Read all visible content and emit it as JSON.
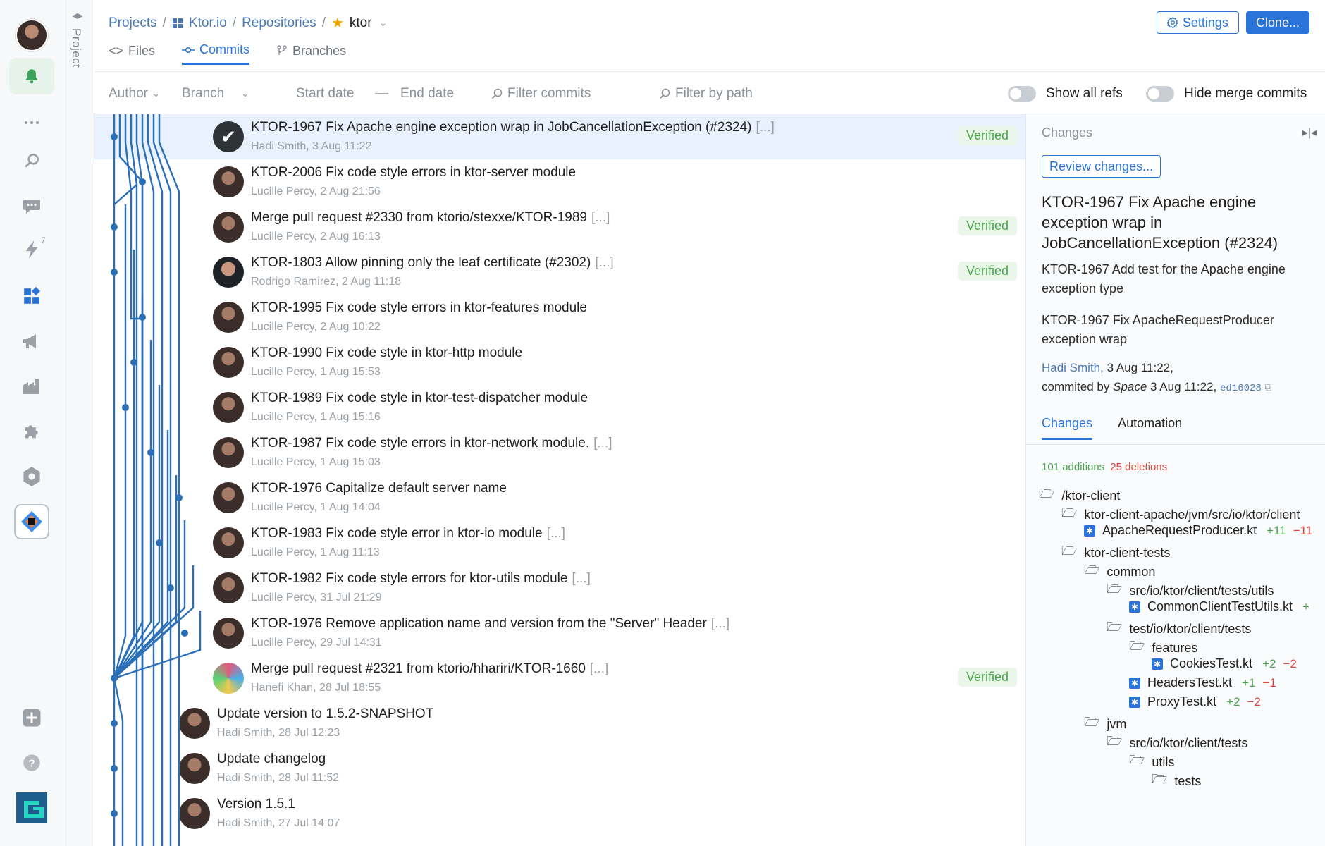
{
  "breadcrumbs": {
    "projects": "Projects",
    "org": "Ktor.io",
    "repos": "Repositories",
    "repo": "ktor"
  },
  "header_buttons": {
    "settings": "Settings",
    "clone": "Clone..."
  },
  "tabs": {
    "files": "Files",
    "commits": "Commits",
    "branches": "Branches"
  },
  "sidebar": {
    "project_label": "Project",
    "lightning_count": "7"
  },
  "filters": {
    "author": "Author",
    "branch": "Branch",
    "start_date": "Start date",
    "dash": "—",
    "end_date": "End date",
    "filter_commits": "Filter commits",
    "filter_path": "Filter by path",
    "show_all_refs": "Show all refs",
    "hide_merge": "Hide merge commits"
  },
  "commits": [
    {
      "title": "KTOR-1967 Fix Apache engine exception wrap in JobCancellationException (#2324)",
      "more": "[...]",
      "meta": "Hadi Smith, 3 Aug 11:22",
      "verified": "Verified"
    },
    {
      "title": "KTOR-2006 Fix code style errors in ktor-server module",
      "more": "",
      "meta": "Lucille Percy, 2 Aug 21:56",
      "verified": ""
    },
    {
      "title": "Merge pull request #2330 from ktorio/stexxe/KTOR-1989",
      "more": "[...]",
      "meta": "Lucille Percy, 2 Aug 16:13",
      "verified": "Verified"
    },
    {
      "title": "KTOR-1803 Allow pinning only the leaf certificate (#2302)",
      "more": "[...]",
      "meta": "Rodrigo Ramirez, 2 Aug 11:18",
      "verified": "Verified"
    },
    {
      "title": "KTOR-1995 Fix code style errors in ktor-features module",
      "more": "",
      "meta": "Lucille Percy, 2 Aug 10:22",
      "verified": ""
    },
    {
      "title": "KTOR-1990 Fix code style in ktor-http module",
      "more": "",
      "meta": "Lucille Percy, 1 Aug 15:53",
      "verified": ""
    },
    {
      "title": "KTOR-1989 Fix code style in ktor-test-dispatcher module",
      "more": "",
      "meta": "Lucille Percy, 1 Aug 15:16",
      "verified": ""
    },
    {
      "title": "KTOR-1987 Fix code style errors in ktor-network module.",
      "more": "[...]",
      "meta": "Lucille Percy, 1 Aug 15:03",
      "verified": ""
    },
    {
      "title": "KTOR-1976 Capitalize default server name",
      "more": "",
      "meta": "Lucille Percy, 1 Aug 14:04",
      "verified": ""
    },
    {
      "title": "KTOR-1983 Fix code style error in ktor-io module",
      "more": "[...]",
      "meta": "Lucille Percy, 1 Aug 11:13",
      "verified": ""
    },
    {
      "title": "KTOR-1982 Fix code style errors for ktor-utils module",
      "more": "[...]",
      "meta": "Lucille Percy, 31 Jul 21:29",
      "verified": ""
    },
    {
      "title": "KTOR-1976 Remove application name and version from the \"Server\" Header",
      "more": "[...]",
      "meta": "Lucille Percy, 29 Jul 14:31",
      "verified": ""
    },
    {
      "title": "Merge pull request #2321 from ktorio/hhariri/KTOR-1660",
      "more": "[...]",
      "meta": "Hanefi Khan, 28 Jul 18:55",
      "verified": "Verified"
    },
    {
      "title": "Update version to 1.5.2-SNAPSHOT",
      "more": "",
      "meta": "Hadi Smith, 28 Jul 12:23",
      "verified": ""
    },
    {
      "title": "Update changelog",
      "more": "",
      "meta": "Hadi Smith, 28 Jul 11:52",
      "verified": ""
    },
    {
      "title": "Version 1.5.1",
      "more": "",
      "meta": "Hadi Smith, 27 Jul 14:07",
      "verified": ""
    }
  ],
  "panel": {
    "heading": "Changes",
    "review_button": "Review changes...",
    "commit_title": "KTOR-1967 Fix Apache engine exception wrap in JobCancellationException (#2324)",
    "desc1": "KTOR-1967 Add test for the Apache engine exception type",
    "desc2": "KTOR-1967 Fix ApacheRequestProducer exception wrap",
    "author_link": "Hadi Smith,",
    "author_date": "3 Aug 11:22,",
    "committed_prefix": "commited by",
    "committer": "Space",
    "committed_date": "3 Aug 11:22,",
    "hash": "ed16028",
    "tab_changes": "Changes",
    "tab_automation": "Automation",
    "additions": "101 additions",
    "deletions": "25 deletions"
  },
  "tree": [
    {
      "name": "/ktor-client",
      "kind": "folder",
      "add": "",
      "del": ""
    },
    {
      "name": "ktor-client-apache/jvm/src/io/ktor/client",
      "kind": "folder",
      "add": "",
      "del": ""
    },
    {
      "name": "ApacheRequestProducer.kt",
      "kind": "file",
      "add": "+11",
      "del": "−11"
    },
    {
      "name": "ktor-client-tests",
      "kind": "folder",
      "add": "",
      "del": ""
    },
    {
      "name": "common",
      "kind": "folder",
      "add": "",
      "del": ""
    },
    {
      "name": "src/io/ktor/client/tests/utils",
      "kind": "folder",
      "add": "",
      "del": ""
    },
    {
      "name": "CommonClientTestUtils.kt",
      "kind": "file",
      "add": "+",
      "del": ""
    },
    {
      "name": "test/io/ktor/client/tests",
      "kind": "folder",
      "add": "",
      "del": ""
    },
    {
      "name": "features",
      "kind": "folder",
      "add": "",
      "del": ""
    },
    {
      "name": "CookiesTest.kt",
      "kind": "file",
      "add": "+2",
      "del": "−2"
    },
    {
      "name": "HeadersTest.kt",
      "kind": "file",
      "add": "+1",
      "del": "−1"
    },
    {
      "name": "ProxyTest.kt",
      "kind": "file",
      "add": "+2",
      "del": "−2"
    },
    {
      "name": "jvm",
      "kind": "folder",
      "add": "",
      "del": ""
    },
    {
      "name": "src/io/ktor/client/tests",
      "kind": "folder",
      "add": "",
      "del": ""
    },
    {
      "name": "utils",
      "kind": "folder",
      "add": "",
      "del": ""
    },
    {
      "name": "tests",
      "kind": "folder",
      "add": "",
      "del": ""
    }
  ],
  "colors": {
    "accent": "#2a74d9",
    "graph": "#2a6fb8",
    "verified_bg": "#eaf6ea",
    "verified_text": "#4aa44e",
    "deletion": "#e0443c"
  }
}
